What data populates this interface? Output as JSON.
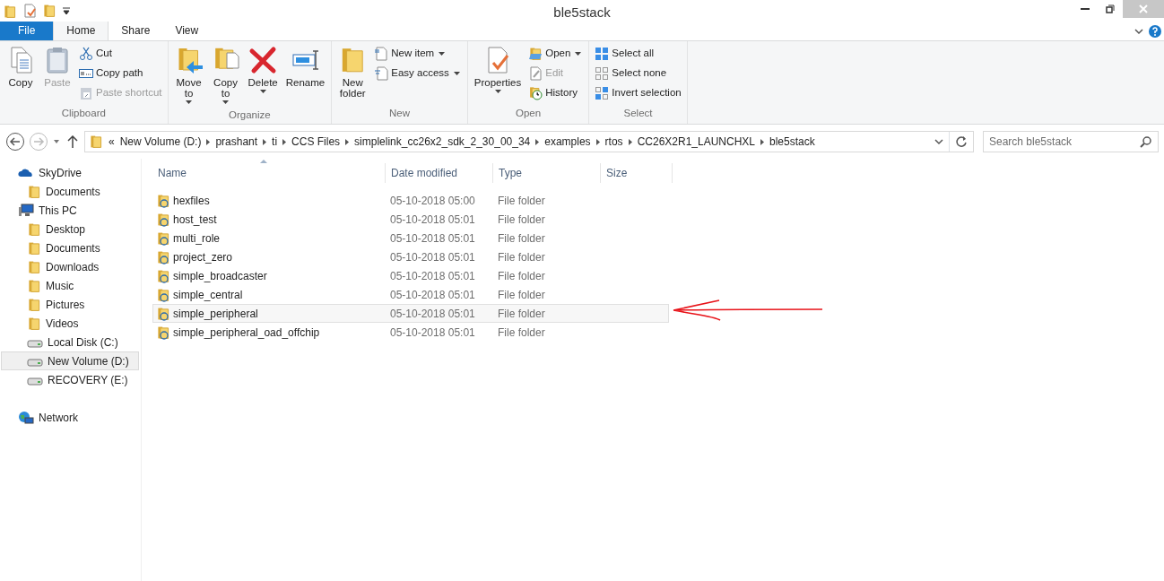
{
  "window": {
    "title": "ble5stack"
  },
  "ribbon_tabs": [
    {
      "label": "File",
      "kind": "file",
      "selected": false
    },
    {
      "label": "Home",
      "kind": "tab",
      "selected": true
    },
    {
      "label": "Share",
      "kind": "tab",
      "selected": false
    },
    {
      "label": "View",
      "kind": "tab",
      "selected": false
    }
  ],
  "ribbon_groups": [
    {
      "label": "Clipboard",
      "items": [
        {
          "label": "Copy",
          "kind": "large",
          "disabled": false,
          "dropdown": false
        },
        {
          "label": "Paste",
          "kind": "large",
          "disabled": true,
          "dropdown": false
        },
        {
          "label": "Cut",
          "kind": "small",
          "disabled": false,
          "dropdown": false
        },
        {
          "label": "Copy path",
          "kind": "small",
          "disabled": false,
          "dropdown": false
        },
        {
          "label": "Paste shortcut",
          "kind": "small",
          "disabled": true,
          "dropdown": false
        }
      ]
    },
    {
      "label": "Organize",
      "items": [
        {
          "label": "Move\nto",
          "kind": "large",
          "disabled": false,
          "dropdown": true
        },
        {
          "label": "Copy\nto",
          "kind": "large",
          "disabled": false,
          "dropdown": true
        },
        {
          "label": "Delete",
          "kind": "large",
          "disabled": false,
          "dropdown": true
        },
        {
          "label": "Rename",
          "kind": "large",
          "disabled": false,
          "dropdown": false
        }
      ]
    },
    {
      "label": "New",
      "items": [
        {
          "label": "New\nfolder",
          "kind": "large",
          "disabled": false,
          "dropdown": false
        },
        {
          "label": "New item",
          "kind": "small",
          "disabled": false,
          "dropdown": true
        },
        {
          "label": "Easy access",
          "kind": "small",
          "disabled": false,
          "dropdown": true
        }
      ]
    },
    {
      "label": "Open",
      "items": [
        {
          "label": "Properties",
          "kind": "large",
          "disabled": false,
          "dropdown": true
        },
        {
          "label": "Open",
          "kind": "small",
          "disabled": false,
          "dropdown": true
        },
        {
          "label": "Edit",
          "kind": "small",
          "disabled": true,
          "dropdown": false
        },
        {
          "label": "History",
          "kind": "small",
          "disabled": false,
          "dropdown": false
        }
      ]
    },
    {
      "label": "Select",
      "items": [
        {
          "label": "Select all",
          "kind": "small",
          "disabled": false,
          "dropdown": false
        },
        {
          "label": "Select none",
          "kind": "small",
          "disabled": false,
          "dropdown": false
        },
        {
          "label": "Invert selection",
          "kind": "small",
          "disabled": false,
          "dropdown": false
        }
      ]
    }
  ],
  "address_bar": {
    "overflow": "«",
    "path": [
      "New Volume (D:)",
      "prashant",
      "ti",
      "CCS Files",
      "simplelink_cc26x2_sdk_2_30_00_34",
      "examples",
      "rtos",
      "CC26X2R1_LAUNCHXL",
      "ble5stack"
    ]
  },
  "search": {
    "placeholder": "Search ble5stack"
  },
  "navigation": [
    {
      "label": "SkyDrive",
      "selected": false,
      "children": [
        {
          "label": "Documents",
          "selected": false
        }
      ]
    },
    {
      "label": "This PC",
      "selected": false,
      "children": [
        {
          "label": "Desktop",
          "selected": false
        },
        {
          "label": "Documents",
          "selected": false
        },
        {
          "label": "Downloads",
          "selected": false
        },
        {
          "label": "Music",
          "selected": false
        },
        {
          "label": "Pictures",
          "selected": false
        },
        {
          "label": "Videos",
          "selected": false
        },
        {
          "label": "Local Disk (C:)",
          "selected": false
        },
        {
          "label": "New Volume (D:)",
          "selected": true
        },
        {
          "label": "RECOVERY (E:)",
          "selected": false
        }
      ]
    },
    {
      "label": "Network",
      "selected": false
    }
  ],
  "file_list": {
    "columns": [
      "Name",
      "Date modified",
      "Type",
      "Size"
    ],
    "rows": [
      {
        "name": "hexfiles",
        "date": "05-10-2018 05:00",
        "type": "File folder",
        "selected": false
      },
      {
        "name": "host_test",
        "date": "05-10-2018 05:01",
        "type": "File folder",
        "selected": false
      },
      {
        "name": "multi_role",
        "date": "05-10-2018 05:01",
        "type": "File folder",
        "selected": false
      },
      {
        "name": "project_zero",
        "date": "05-10-2018 05:01",
        "type": "File folder",
        "selected": false
      },
      {
        "name": "simple_broadcaster",
        "date": "05-10-2018 05:01",
        "type": "File folder",
        "selected": false
      },
      {
        "name": "simple_central",
        "date": "05-10-2018 05:01",
        "type": "File folder",
        "selected": false
      },
      {
        "name": "simple_peripheral",
        "date": "05-10-2018 05:01",
        "type": "File folder",
        "selected": true
      },
      {
        "name": "simple_peripheral_oad_offchip",
        "date": "05-10-2018 05:01",
        "type": "File folder",
        "selected": false
      }
    ]
  }
}
